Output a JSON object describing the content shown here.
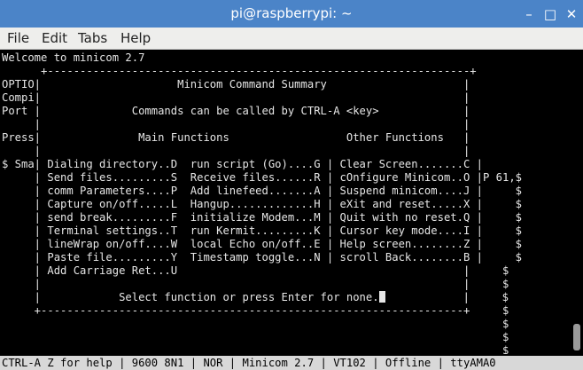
{
  "window": {
    "title": "pi@raspberrypi: ~",
    "minimize": "–",
    "maximize": "□",
    "close": "✕"
  },
  "menu": [
    "File",
    "Edit",
    "Tabs",
    "Help"
  ],
  "terminal": {
    "lines": [
      "Welcome to minicom 2.7",
      "      +-----------------------------------------------------------------+",
      "OPTIO|                     Minicom Command Summary                     |",
      "Compi|                                                                 |",
      "Port |              Commands can be called by CTRL-A <key>             |",
      "     |                                                                 |",
      "Press|               Main Functions                  Other Functions   |",
      "     |                                                                 |",
      "$ Sma| Dialing directory..D  run script (Go)....G | Clear Screen.......C |",
      "     | Send files.........S  Receive files......R | cOnfigure Minicom..O |P 61,$",
      "     | comm Parameters....P  Add linefeed.......A | Suspend minicom....J |     $",
      "     | Capture on/off.....L  Hangup.............H | eXit and reset.....X |     $",
      "     | send break.........F  initialize Modem...M | Quit with no reset.Q |     $",
      "     | Terminal settings..T  run Kermit.........K | Cursor key mode....I |     $",
      "     | lineWrap on/off....W  local Echo on/off..E | Help screen........Z |     $",
      "     | Paste file.........Y  Timestamp toggle...N | scroll Back........B |     $",
      "     | Add Carriage Ret...U                                            |     $",
      "     |                                                                 |     $",
      "     |            Select function or press Enter for none.             |     $",
      "     +-----------------------------------------------------------------+     $",
      "                                                                             $",
      "                                                                             $",
      "                                                                             $"
    ]
  },
  "statusbar": {
    "text": "CTRL-A Z for help | 9600 8N1 | NOR | Minicom 2.7 | VT102 | Offline | ttyAMA0"
  },
  "colors": {
    "titlebar": "#4b84c8",
    "menubar": "#eeeeec",
    "terminal_bg": "#000000",
    "terminal_fg": "#e6e6e6",
    "statusbar": "#d8d8d8"
  }
}
